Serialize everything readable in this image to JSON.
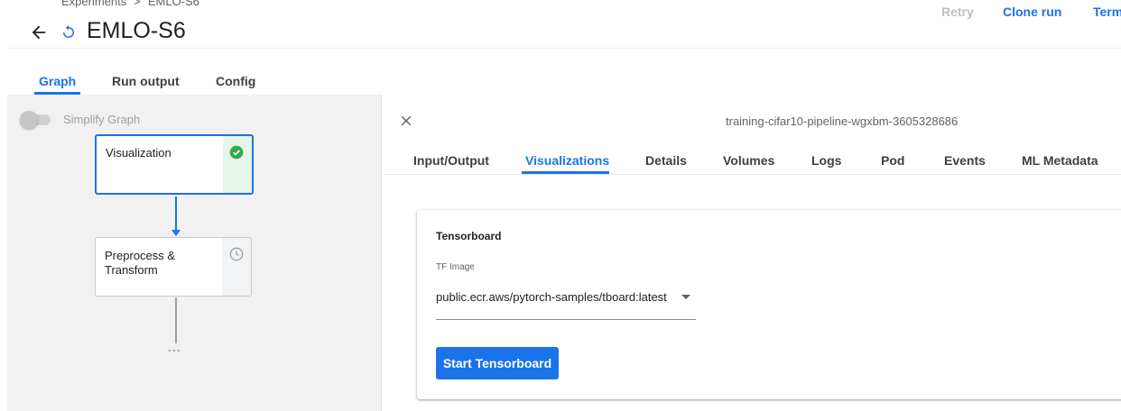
{
  "breadcrumb": {
    "parent": "Experiments",
    "separator": ">",
    "current": "EMLO-S6"
  },
  "header": {
    "title": "EMLO-S6",
    "actions": {
      "retry": "Retry",
      "clone": "Clone run",
      "terminate": "Term"
    }
  },
  "main_tabs": [
    "Graph",
    "Run output",
    "Config"
  ],
  "graph": {
    "simplify_label": "Simplify Graph",
    "nodes": [
      {
        "label": "Visualization",
        "status_icon": "check-circle-icon",
        "status_color": "#34a853"
      },
      {
        "label": "Preprocess & Transform",
        "status_icon": "clock-icon",
        "status_color": "#9aa0a6"
      }
    ],
    "more_indicator": "..."
  },
  "side_panel": {
    "pod_name": "training-cifar10-pipeline-wgxbm-3605328686",
    "tabs": [
      "Input/Output",
      "Visualizations",
      "Details",
      "Volumes",
      "Logs",
      "Pod",
      "Events",
      "ML Metadata"
    ],
    "active_tab": "Visualizations",
    "card": {
      "title": "Tensorboard",
      "field_label": "TF Image",
      "selected_value": "public.ecr.aws/pytorch-samples/tboard:latest",
      "button_label": "Start Tensorboard"
    }
  },
  "colors": {
    "accent": "#1a73e8",
    "success": "#34a853"
  }
}
